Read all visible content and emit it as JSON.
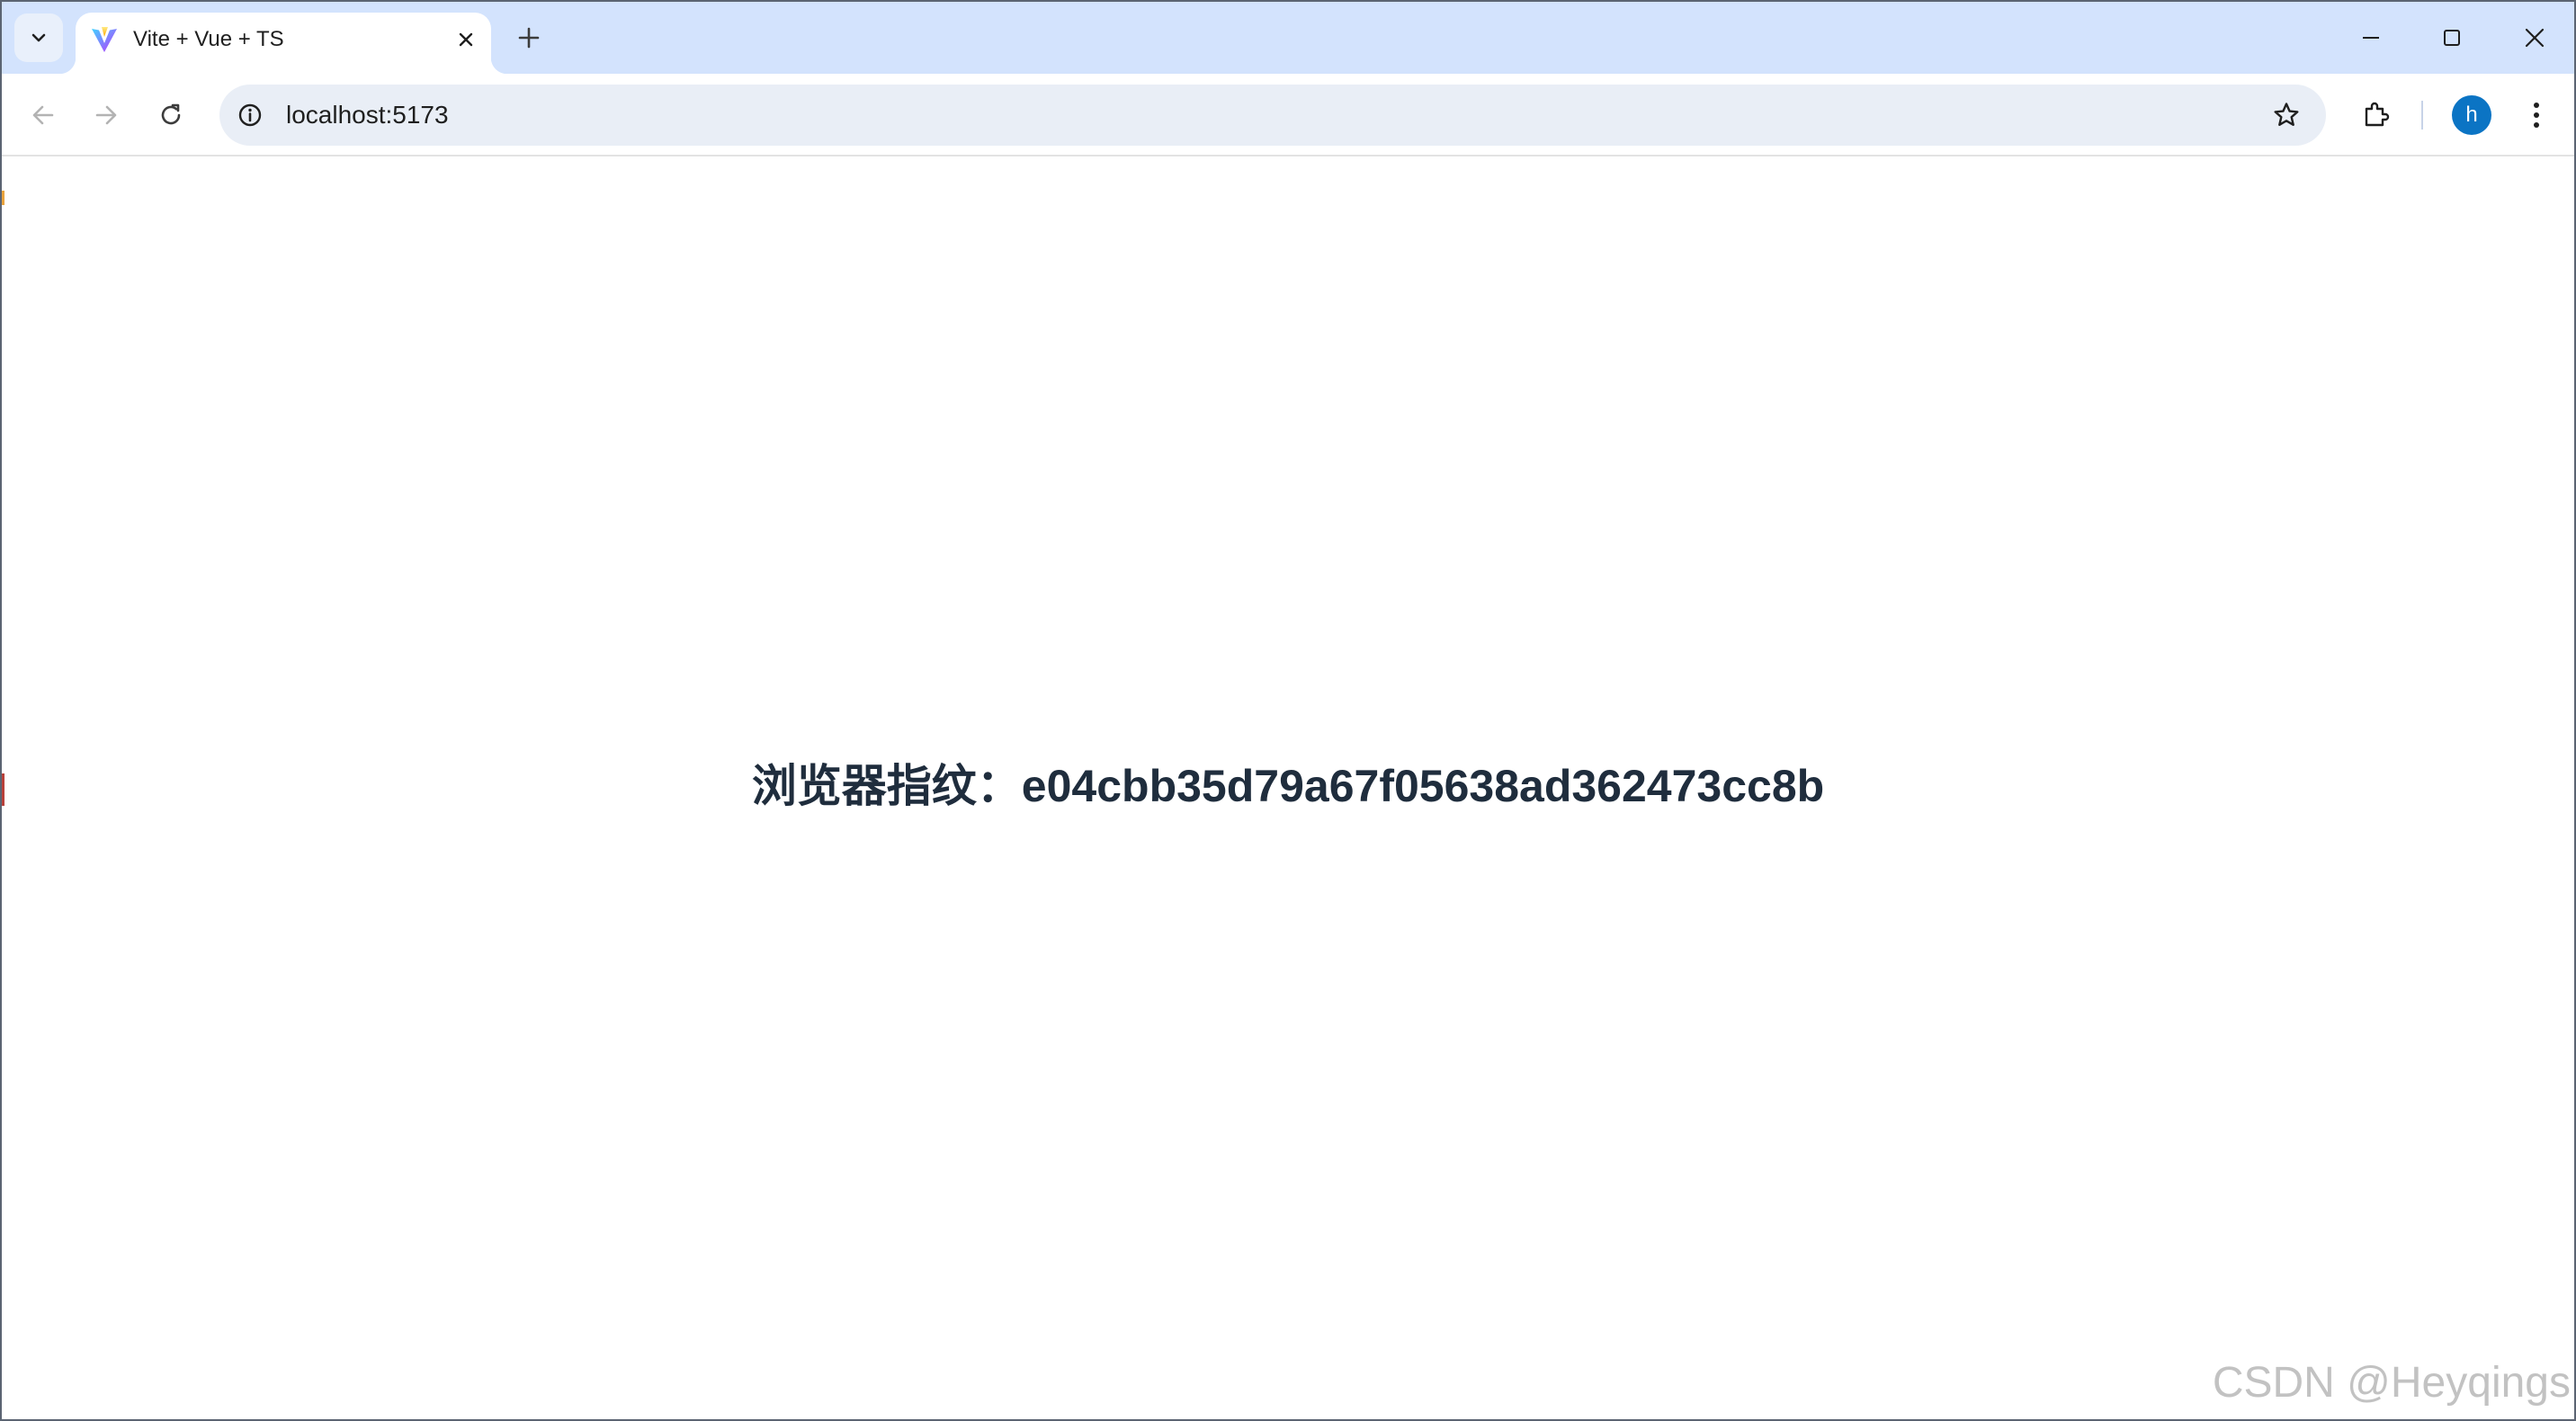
{
  "browser": {
    "tab": {
      "title": "Vite + Vue + TS",
      "favicon": "vite-logo-icon"
    },
    "address_bar": {
      "url": "localhost:5173",
      "site_info_icon": "info-icon",
      "bookmark_icon": "star-icon"
    },
    "profile": {
      "initial": "h",
      "color": "#0b74c4"
    },
    "icons": {
      "tab_search": "chevron-down-icon",
      "tab_close": "close-icon",
      "new_tab": "plus-icon",
      "back": "arrow-left-icon",
      "forward": "arrow-right-icon",
      "reload": "reload-icon",
      "extensions": "puzzle-icon",
      "menu": "kebab-menu-icon",
      "minimize": "minimize-icon",
      "maximize": "maximize-icon",
      "close": "close-icon"
    },
    "colors": {
      "tabstrip": "#d3e3fd",
      "omnibox": "#e9eef6"
    }
  },
  "page": {
    "fingerprint_text": "浏览器指纹：e04cbb35d79a67f05638ad362473cc8b",
    "text_color": "#1f2d3d"
  },
  "watermark": {
    "text": "CSDN @Heyqings"
  }
}
